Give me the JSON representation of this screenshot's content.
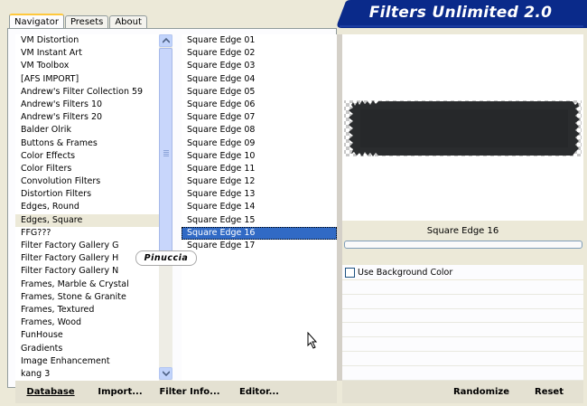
{
  "app": {
    "title": "Filters Unlimited 2.0",
    "banner_color": "#0a2a8a"
  },
  "tabs": [
    {
      "label": "Navigator",
      "active": true
    },
    {
      "label": "Presets",
      "active": false
    },
    {
      "label": "About",
      "active": false
    }
  ],
  "categories": {
    "items": [
      "VM Distortion",
      "VM Instant Art",
      "VM Toolbox",
      "[AFS IMPORT]",
      "Andrew's Filter Collection 59",
      "Andrew's Filters 10",
      "Andrew's Filters 20",
      "Balder Olrik",
      "Buttons & Frames",
      "Color Effects",
      "Color Filters",
      "Convolution Filters",
      "Distortion Filters",
      "Edges, Round",
      "Edges, Square",
      "FFG???",
      "Filter Factory Gallery G",
      "Filter Factory Gallery H",
      "Filter Factory Gallery N",
      "Frames, Marble & Crystal",
      "Frames, Stone & Granite",
      "Frames, Textured",
      "Frames, Wood",
      "FunHouse",
      "Gradients",
      "Image Enhancement",
      "kang 3"
    ],
    "selected": "Edges, Square"
  },
  "filters": {
    "items": [
      "Square Edge 01",
      "Square Edge 02",
      "Square Edge 03",
      "Square Edge 04",
      "Square Edge 05",
      "Square Edge 06",
      "Square Edge 07",
      "Square Edge 08",
      "Square Edge 09",
      "Square Edge 10",
      "Square Edge 11",
      "Square Edge 12",
      "Square Edge 13",
      "Square Edge 14",
      "Square Edge 15",
      "Square Edge 16",
      "Square Edge 17"
    ],
    "selected": "Square Edge 16"
  },
  "preview": {
    "filter_name": "Square Edge 16",
    "use_background_label": "Use Background Color",
    "use_background_checked": false
  },
  "watermark": "Pinuccia",
  "bottom_bar": {
    "database": "Database",
    "import": "Import...",
    "filter_info": "Filter Info...",
    "editor": "Editor...",
    "randomize": "Randomize",
    "reset": "Reset"
  },
  "icons": {
    "scroll_up": "scroll-up-arrow-icon",
    "scroll_down": "scroll-down-arrow-icon",
    "cursor": "mouse-pointer-icon"
  }
}
